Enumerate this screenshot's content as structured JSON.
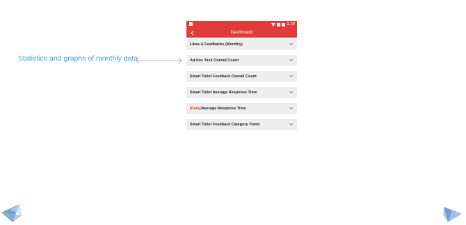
{
  "annotation": {
    "text": "Statistics and graphs of monthly data"
  },
  "status_bar": {
    "time": "1:28"
  },
  "app_bar": {
    "title": "Dashboard",
    "back_icon": "chevron-left-icon"
  },
  "items": [
    {
      "prefix": "",
      "label": "Likes & Feedbacks (Monthly)"
    },
    {
      "prefix": "",
      "label": "Ad-hoc Task Overall Count"
    },
    {
      "prefix": "",
      "label": "Smart Toilet Feedback Overall Count"
    },
    {
      "prefix": "",
      "label": "Smart Toilet Average Response Time"
    },
    {
      "prefix": "[Daily]",
      "label": "Average Response Time"
    },
    {
      "prefix": "",
      "label": "Smart Toilet Feedback Category Trend"
    }
  ],
  "colors": {
    "accent": "#e23b3b",
    "annotation": "#3aa0d6",
    "item_bg": "#eeeeee"
  }
}
